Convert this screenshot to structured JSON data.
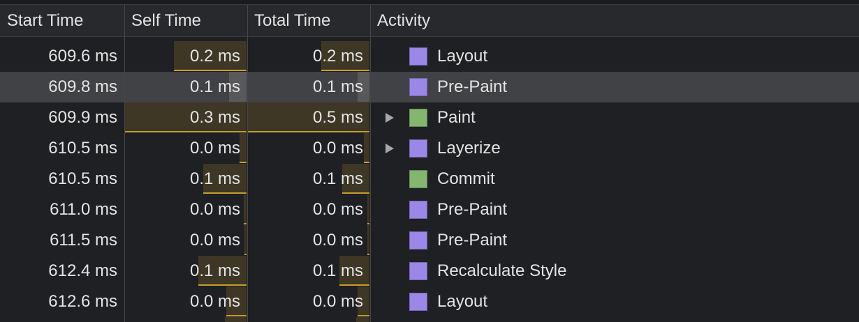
{
  "columns": {
    "start_time": "Start Time",
    "self_time": "Self Time",
    "total_time": "Total Time",
    "activity": "Activity"
  },
  "colors": {
    "rendering_purple": "#9b87e8",
    "painting_green": "#84b66f",
    "bar_gold": "#c69c2c"
  },
  "rows": [
    {
      "start": "609.6 ms",
      "self": "0.2 ms",
      "total": "0.2 ms",
      "activity": "Layout",
      "category": "rendering",
      "expandable": false,
      "selected": false,
      "self_fraction": 0.6,
      "total_fraction": 0.4
    },
    {
      "start": "609.8 ms",
      "self": "0.1 ms",
      "total": "0.1 ms",
      "activity": "Pre-Paint",
      "category": "rendering",
      "expandable": false,
      "selected": true,
      "self_fraction": 0.15,
      "total_fraction": 0.1
    },
    {
      "start": "609.9 ms",
      "self": "0.3 ms",
      "total": "0.5 ms",
      "activity": "Paint",
      "category": "painting",
      "expandable": true,
      "selected": false,
      "self_fraction": 1.0,
      "total_fraction": 1.0
    },
    {
      "start": "610.5 ms",
      "self": "0.0 ms",
      "total": "0.0 ms",
      "activity": "Layerize",
      "category": "rendering",
      "expandable": true,
      "selected": false,
      "self_fraction": 0.06,
      "total_fraction": 0.05
    },
    {
      "start": "610.5 ms",
      "self": "0.1 ms",
      "total": "0.1 ms",
      "activity": "Commit",
      "category": "painting",
      "expandable": false,
      "selected": false,
      "self_fraction": 0.36,
      "total_fraction": 0.23
    },
    {
      "start": "611.0 ms",
      "self": "0.0 ms",
      "total": "0.0 ms",
      "activity": "Pre-Paint",
      "category": "rendering",
      "expandable": false,
      "selected": false,
      "self_fraction": 0.03,
      "total_fraction": 0.02
    },
    {
      "start": "611.5 ms",
      "self": "0.0 ms",
      "total": "0.0 ms",
      "activity": "Pre-Paint",
      "category": "rendering",
      "expandable": false,
      "selected": false,
      "self_fraction": 0.02,
      "total_fraction": 0.02
    },
    {
      "start": "612.4 ms",
      "self": "0.1 ms",
      "total": "0.1 ms",
      "activity": "Recalculate Style",
      "category": "rendering",
      "expandable": false,
      "selected": false,
      "self_fraction": 0.4,
      "total_fraction": 0.25
    },
    {
      "start": "612.6 ms",
      "self": "0.0 ms",
      "total": "0.0 ms",
      "activity": "Layout",
      "category": "rendering",
      "expandable": false,
      "selected": false,
      "self_fraction": 0.17,
      "total_fraction": 0.1
    }
  ]
}
